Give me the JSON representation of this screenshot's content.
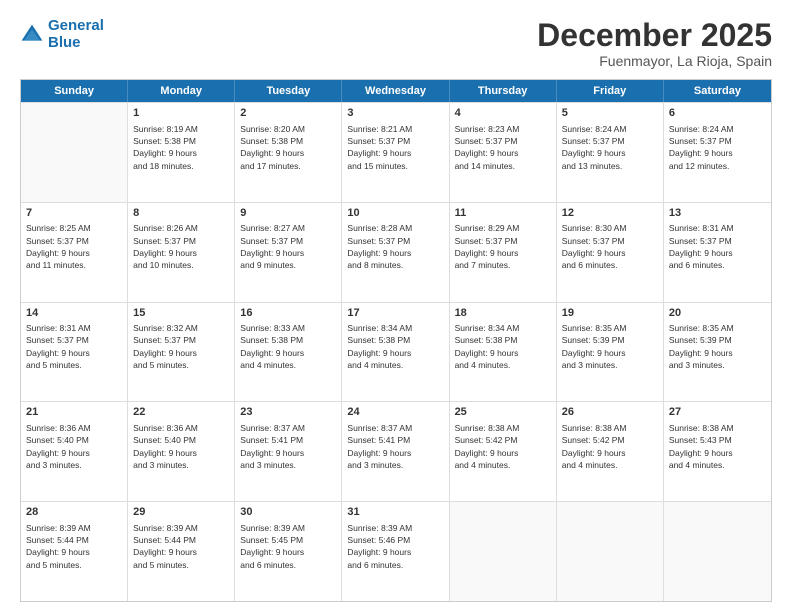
{
  "logo": {
    "line1": "General",
    "line2": "Blue"
  },
  "title": "December 2025",
  "location": "Fuenmayor, La Rioja, Spain",
  "header_days": [
    "Sunday",
    "Monday",
    "Tuesday",
    "Wednesday",
    "Thursday",
    "Friday",
    "Saturday"
  ],
  "weeks": [
    [
      {
        "day": "",
        "info": ""
      },
      {
        "day": "1",
        "info": "Sunrise: 8:19 AM\nSunset: 5:38 PM\nDaylight: 9 hours\nand 18 minutes."
      },
      {
        "day": "2",
        "info": "Sunrise: 8:20 AM\nSunset: 5:38 PM\nDaylight: 9 hours\nand 17 minutes."
      },
      {
        "day": "3",
        "info": "Sunrise: 8:21 AM\nSunset: 5:37 PM\nDaylight: 9 hours\nand 15 minutes."
      },
      {
        "day": "4",
        "info": "Sunrise: 8:23 AM\nSunset: 5:37 PM\nDaylight: 9 hours\nand 14 minutes."
      },
      {
        "day": "5",
        "info": "Sunrise: 8:24 AM\nSunset: 5:37 PM\nDaylight: 9 hours\nand 13 minutes."
      },
      {
        "day": "6",
        "info": "Sunrise: 8:24 AM\nSunset: 5:37 PM\nDaylight: 9 hours\nand 12 minutes."
      }
    ],
    [
      {
        "day": "7",
        "info": "Sunrise: 8:25 AM\nSunset: 5:37 PM\nDaylight: 9 hours\nand 11 minutes."
      },
      {
        "day": "8",
        "info": "Sunrise: 8:26 AM\nSunset: 5:37 PM\nDaylight: 9 hours\nand 10 minutes."
      },
      {
        "day": "9",
        "info": "Sunrise: 8:27 AM\nSunset: 5:37 PM\nDaylight: 9 hours\nand 9 minutes."
      },
      {
        "day": "10",
        "info": "Sunrise: 8:28 AM\nSunset: 5:37 PM\nDaylight: 9 hours\nand 8 minutes."
      },
      {
        "day": "11",
        "info": "Sunrise: 8:29 AM\nSunset: 5:37 PM\nDaylight: 9 hours\nand 7 minutes."
      },
      {
        "day": "12",
        "info": "Sunrise: 8:30 AM\nSunset: 5:37 PM\nDaylight: 9 hours\nand 6 minutes."
      },
      {
        "day": "13",
        "info": "Sunrise: 8:31 AM\nSunset: 5:37 PM\nDaylight: 9 hours\nand 6 minutes."
      }
    ],
    [
      {
        "day": "14",
        "info": "Sunrise: 8:31 AM\nSunset: 5:37 PM\nDaylight: 9 hours\nand 5 minutes."
      },
      {
        "day": "15",
        "info": "Sunrise: 8:32 AM\nSunset: 5:37 PM\nDaylight: 9 hours\nand 5 minutes."
      },
      {
        "day": "16",
        "info": "Sunrise: 8:33 AM\nSunset: 5:38 PM\nDaylight: 9 hours\nand 4 minutes."
      },
      {
        "day": "17",
        "info": "Sunrise: 8:34 AM\nSunset: 5:38 PM\nDaylight: 9 hours\nand 4 minutes."
      },
      {
        "day": "18",
        "info": "Sunrise: 8:34 AM\nSunset: 5:38 PM\nDaylight: 9 hours\nand 4 minutes."
      },
      {
        "day": "19",
        "info": "Sunrise: 8:35 AM\nSunset: 5:39 PM\nDaylight: 9 hours\nand 3 minutes."
      },
      {
        "day": "20",
        "info": "Sunrise: 8:35 AM\nSunset: 5:39 PM\nDaylight: 9 hours\nand 3 minutes."
      }
    ],
    [
      {
        "day": "21",
        "info": "Sunrise: 8:36 AM\nSunset: 5:40 PM\nDaylight: 9 hours\nand 3 minutes."
      },
      {
        "day": "22",
        "info": "Sunrise: 8:36 AM\nSunset: 5:40 PM\nDaylight: 9 hours\nand 3 minutes."
      },
      {
        "day": "23",
        "info": "Sunrise: 8:37 AM\nSunset: 5:41 PM\nDaylight: 9 hours\nand 3 minutes."
      },
      {
        "day": "24",
        "info": "Sunrise: 8:37 AM\nSunset: 5:41 PM\nDaylight: 9 hours\nand 3 minutes."
      },
      {
        "day": "25",
        "info": "Sunrise: 8:38 AM\nSunset: 5:42 PM\nDaylight: 9 hours\nand 4 minutes."
      },
      {
        "day": "26",
        "info": "Sunrise: 8:38 AM\nSunset: 5:42 PM\nDaylight: 9 hours\nand 4 minutes."
      },
      {
        "day": "27",
        "info": "Sunrise: 8:38 AM\nSunset: 5:43 PM\nDaylight: 9 hours\nand 4 minutes."
      }
    ],
    [
      {
        "day": "28",
        "info": "Sunrise: 8:39 AM\nSunset: 5:44 PM\nDaylight: 9 hours\nand 5 minutes."
      },
      {
        "day": "29",
        "info": "Sunrise: 8:39 AM\nSunset: 5:44 PM\nDaylight: 9 hours\nand 5 minutes."
      },
      {
        "day": "30",
        "info": "Sunrise: 8:39 AM\nSunset: 5:45 PM\nDaylight: 9 hours\nand 6 minutes."
      },
      {
        "day": "31",
        "info": "Sunrise: 8:39 AM\nSunset: 5:46 PM\nDaylight: 9 hours\nand 6 minutes."
      },
      {
        "day": "",
        "info": ""
      },
      {
        "day": "",
        "info": ""
      },
      {
        "day": "",
        "info": ""
      }
    ]
  ]
}
